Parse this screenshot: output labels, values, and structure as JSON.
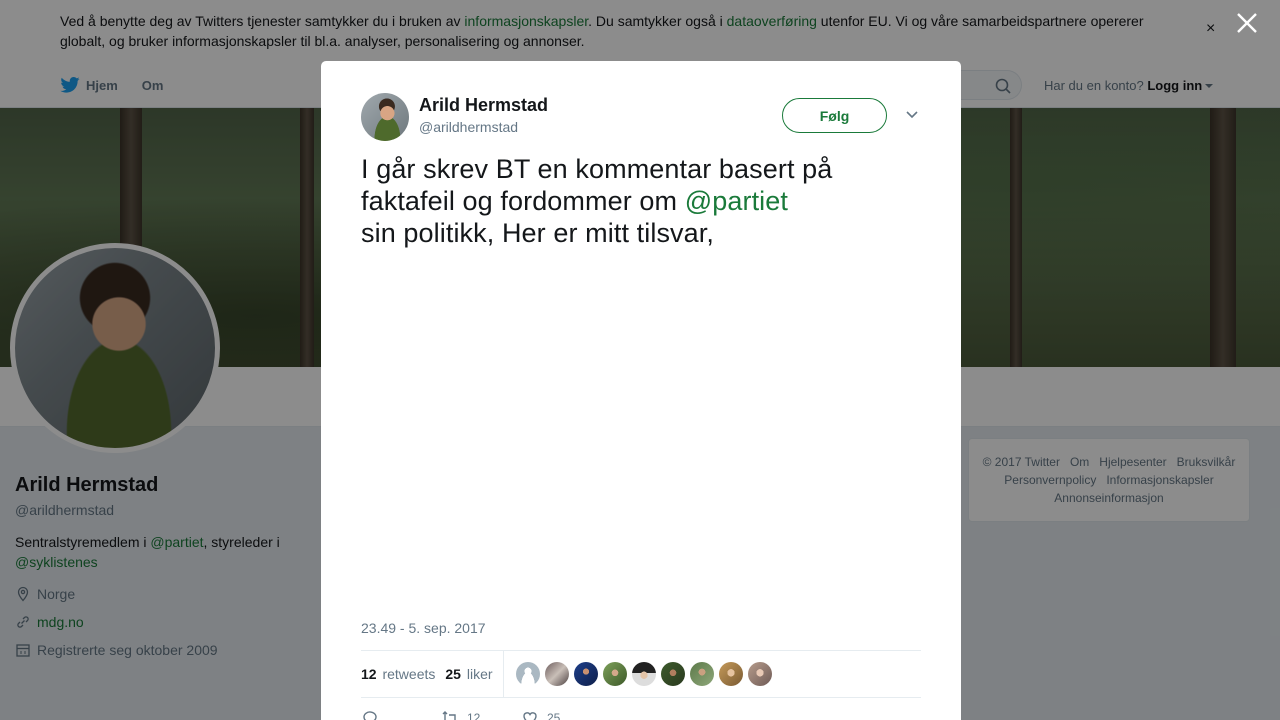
{
  "cookie_banner": {
    "text_1": "Ved å benytte deg av Twitters tjenester samtykker du i bruken av ",
    "link_1": "informasjonskapsler",
    "text_2": ". Du samtykker også i ",
    "link_2": "dataoverføring",
    "text_3": " utenfor EU. Vi og våre samarbeidspartnere opererer globalt, og bruker informasjonskapsler til bl.a. analyser, personalisering og annonser.",
    "close_glyph": "×"
  },
  "nav": {
    "home_label": "Hjem",
    "about_label": "Om",
    "account_prompt": "Har du en konto?",
    "login_label": "Logg inn"
  },
  "profile": {
    "name": "Arild Hermstad",
    "handle": "@arildhermstad",
    "bio_text_1": "Sentralstyremedlem i ",
    "bio_link_1": "@partiet",
    "bio_text_2": ", styreleder i ",
    "bio_link_2": "@syklistenes",
    "location": "Norge",
    "website": "mdg.no",
    "joined": "Registrerte seg oktober 2009"
  },
  "footer": {
    "links": [
      "© 2017 Twitter",
      "Om",
      "Hjelpesenter",
      "Bruksvilkår",
      "Personvernpolicy",
      "Informasjonskapsler",
      "Annonseinformasjon"
    ]
  },
  "tweet": {
    "author_name": "Arild Hermstad",
    "author_handle": "@arildhermstad",
    "follow_label": "Følg",
    "text_1": "I går skrev BT en kommentar basert på faktafeil og fordommer om ",
    "mention": "@partiet",
    "text_2": "sin politikk, Her er mitt tilsvar,",
    "timestamp": "23.49 - 5. sep. 2017",
    "retweets_count": "12",
    "retweets_label": "retweets",
    "likes_count": "25",
    "likes_label": "liker",
    "action_retweet_count": "12",
    "action_like_count": "25"
  },
  "colors": {
    "accent": "#1a7a3a",
    "muted": "#657786"
  }
}
